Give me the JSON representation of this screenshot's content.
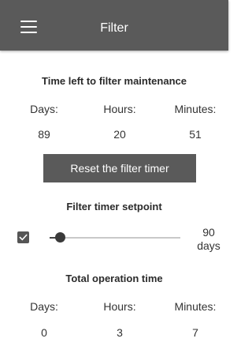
{
  "header": {
    "title": "Filter"
  },
  "maintenance": {
    "heading": "Time left to filter maintenance",
    "labels": {
      "days": "Days:",
      "hours": "Hours:",
      "minutes": "Minutes:"
    },
    "values": {
      "days": "89",
      "hours": "20",
      "minutes": "51"
    },
    "reset_label": "Reset the filter timer"
  },
  "setpoint": {
    "heading": "Filter timer setpoint",
    "enabled": true,
    "slider_fraction": 0.08,
    "value": "90",
    "unit": "days"
  },
  "operation": {
    "heading": "Total operation time",
    "labels": {
      "days": "Days:",
      "hours": "Hours:",
      "minutes": "Minutes:"
    },
    "values": {
      "days": "0",
      "hours": "3",
      "minutes": "7"
    }
  },
  "colors": {
    "appbar": "#5a5a5a",
    "button": "#5a5a5a",
    "slider_thumb": "#3a3a3a"
  },
  "icons": {
    "menu": "hamburger-menu-icon",
    "checkbox": "check-icon"
  }
}
